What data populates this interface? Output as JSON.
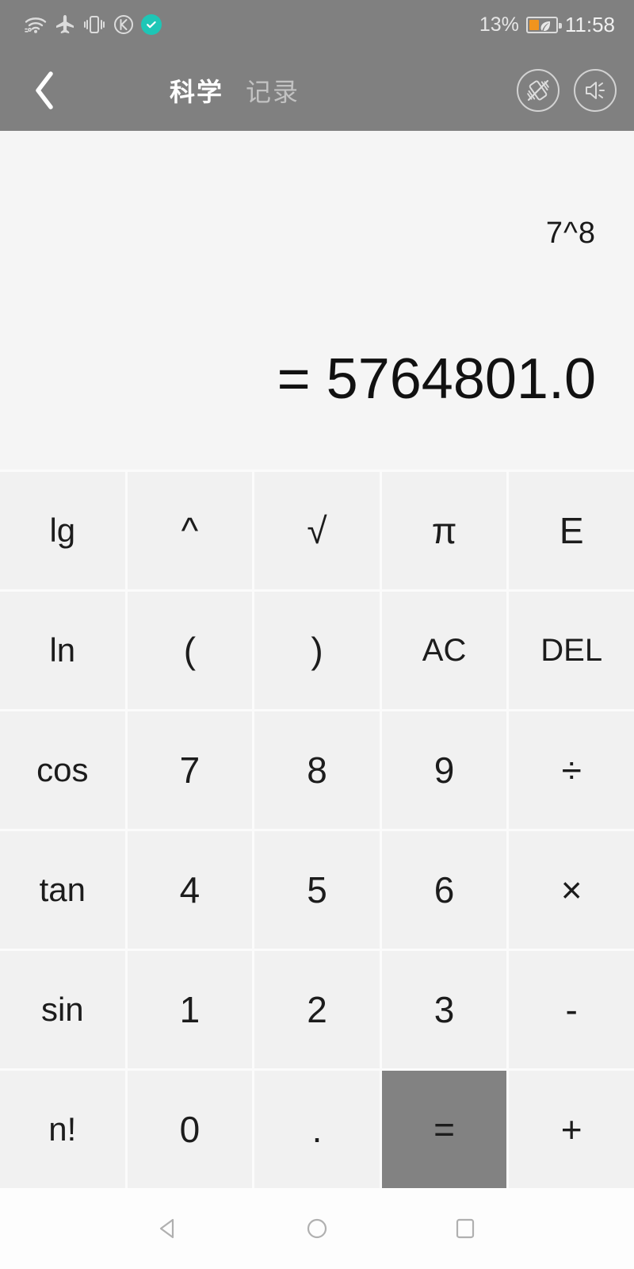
{
  "status_bar": {
    "icons": [
      "wifi-icon",
      "airplane-mode-icon",
      "vibrate-icon",
      "k-circle-icon",
      "check-badge-icon"
    ],
    "battery_percent": "13%",
    "battery_level": 13,
    "battery_saver": "leaf-icon",
    "time": "11:58",
    "background_color": "#808080"
  },
  "app_bar": {
    "back_label": "‹",
    "tabs": [
      {
        "label": "科学",
        "active": true
      },
      {
        "label": "记录",
        "active": false
      }
    ],
    "actions": [
      {
        "name": "vibration-off-icon"
      },
      {
        "name": "sound-icon"
      }
    ]
  },
  "display": {
    "expression": "7^8",
    "result": "= 5764801.0"
  },
  "keypad": {
    "equals_bg": "#828282",
    "key_bg": "#f1f1f1",
    "rows": [
      [
        {
          "label": "lg",
          "name": "key-lg",
          "kind": "fn"
        },
        {
          "label": "^",
          "name": "key-power",
          "kind": "op"
        },
        {
          "label": "√",
          "name": "key-sqrt",
          "kind": "op"
        },
        {
          "label": "π",
          "name": "key-pi",
          "kind": "op"
        },
        {
          "label": "E",
          "name": "key-e",
          "kind": "op"
        }
      ],
      [
        {
          "label": "ln",
          "name": "key-ln",
          "kind": "fn"
        },
        {
          "label": "(",
          "name": "key-paren-open",
          "kind": "op"
        },
        {
          "label": ")",
          "name": "key-paren-close",
          "kind": "op"
        },
        {
          "label": "AC",
          "name": "key-all-clear",
          "kind": "small"
        },
        {
          "label": "DEL",
          "name": "key-delete",
          "kind": "small"
        }
      ],
      [
        {
          "label": "cos",
          "name": "key-cos",
          "kind": "fn"
        },
        {
          "label": "7",
          "name": "key-7",
          "kind": "num"
        },
        {
          "label": "8",
          "name": "key-8",
          "kind": "num"
        },
        {
          "label": "9",
          "name": "key-9",
          "kind": "num"
        },
        {
          "label": "÷",
          "name": "key-divide",
          "kind": "op"
        }
      ],
      [
        {
          "label": "tan",
          "name": "key-tan",
          "kind": "fn"
        },
        {
          "label": "4",
          "name": "key-4",
          "kind": "num"
        },
        {
          "label": "5",
          "name": "key-5",
          "kind": "num"
        },
        {
          "label": "6",
          "name": "key-6",
          "kind": "num"
        },
        {
          "label": "×",
          "name": "key-multiply",
          "kind": "op"
        }
      ],
      [
        {
          "label": "sin",
          "name": "key-sin",
          "kind": "fn"
        },
        {
          "label": "1",
          "name": "key-1",
          "kind": "num"
        },
        {
          "label": "2",
          "name": "key-2",
          "kind": "num"
        },
        {
          "label": "3",
          "name": "key-3",
          "kind": "num"
        },
        {
          "label": "-",
          "name": "key-minus",
          "kind": "op"
        }
      ],
      [
        {
          "label": "n!",
          "name": "key-factorial",
          "kind": "fn"
        },
        {
          "label": "0",
          "name": "key-0",
          "kind": "num"
        },
        {
          "label": ".",
          "name": "key-decimal",
          "kind": "num"
        },
        {
          "label": "=",
          "name": "key-equals",
          "kind": "equals"
        },
        {
          "label": "+",
          "name": "key-plus",
          "kind": "op"
        }
      ]
    ]
  },
  "nav_bar": {
    "buttons": [
      {
        "name": "nav-back-icon"
      },
      {
        "name": "nav-home-icon"
      },
      {
        "name": "nav-recents-icon"
      }
    ]
  }
}
